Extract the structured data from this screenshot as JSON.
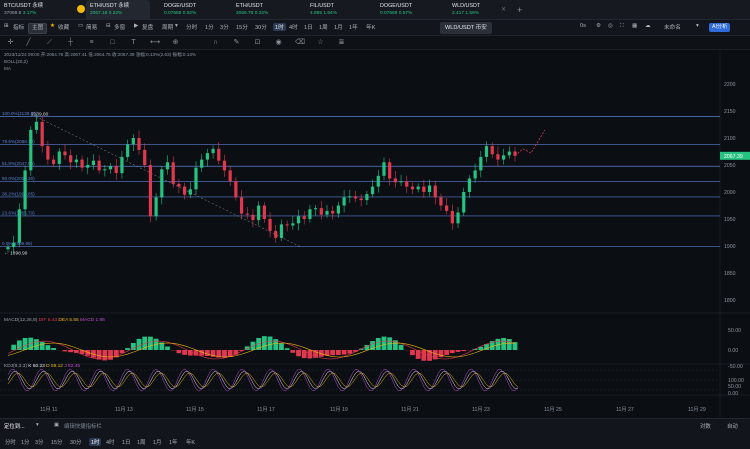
{
  "tabs": [
    {
      "name": "BTC/USDT 永续",
      "price": "37068.8",
      "change": "3.17%"
    },
    {
      "name": "ETH/USDT 永续",
      "price": "2067.18",
      "change": "0.22%"
    },
    {
      "name": "DOGE/USDT",
      "price": "0.07665",
      "change": "0.92%"
    },
    {
      "name": "ETH/USDT",
      "price": "2066.78",
      "change": "0.22%"
    },
    {
      "name": "FIL/USDT",
      "price": "4.895",
      "change": "1.64%"
    },
    {
      "name": "DOGE/USDT",
      "price": "0.07669",
      "change": "0.57%"
    },
    {
      "name": "WLD/USDT",
      "price": "2.417",
      "change": "1.59%"
    }
  ],
  "toolbar": {
    "indicator": "指标",
    "main_label": "主图",
    "favorite": "收藏",
    "simple": "简易",
    "multi": "多窗",
    "replay": "复盘",
    "cycle": "周期",
    "periods": [
      "分时",
      "1分",
      "3分",
      "15分",
      "30分",
      "1时",
      "4时",
      "1日",
      "1周",
      "1月",
      "1年",
      "年K"
    ],
    "selected_period": "1时",
    "pair_badge": "WLD/USDT 币安",
    "zero_s": "0s",
    "unnamed": "未命名",
    "ai": "AI分析"
  },
  "drawing_tools": [
    "cursor",
    "line",
    "ray",
    "cross",
    "fib",
    "shape",
    "text",
    "measure",
    "zoom",
    "magnet",
    "lock",
    "eye",
    "trash",
    "star",
    "layers"
  ],
  "legend": {
    "line1": "2023/11/24 09:00  开:2064.76  高:2067.41  低:2064.75  收:2067.39  涨幅:0.13%(2.63)  振幅:0.13%",
    "line2": "BOLL(20,2)",
    "line3": "MA"
  },
  "macd": {
    "label": "MACD(12,26,9)",
    "dif": "DIF 6.43",
    "dea": "DEA 5.55",
    "macd": "MACD 1.86"
  },
  "kdj": {
    "label": "KDJ(9,3,3)",
    "k": "K 60.23",
    "d": "D 59.12",
    "j": "J 62.45"
  },
  "chart_data": {
    "type": "candlestick",
    "price_axis": [
      2200,
      2150,
      2100,
      2050,
      2000,
      1950,
      1900,
      1850,
      1800
    ],
    "last_price": "2067.39",
    "high_label": "2139.60",
    "low_label": "1898.99",
    "fib_levels": [
      {
        "label": "100.0%(2139.60)",
        "value": 2139.6
      },
      {
        "label": "78.6%(2088.10)",
        "value": 2088.1
      },
      {
        "label": "61.8%(2047.66)",
        "value": 2047.66
      },
      {
        "label": "50.0%(2019.30)",
        "value": 2019.3
      },
      {
        "label": "38.2%(1990.85)",
        "value": 1990.85
      },
      {
        "label": "23.6%(1955.70)",
        "value": 1955.7
      },
      {
        "label": "0.0%(1898.99)",
        "value": 1898.99
      }
    ],
    "macd_axis": [
      "50.00",
      "0.00",
      "-50.00"
    ],
    "kdj_axis": [
      "100.00",
      "50.00",
      "0.00"
    ],
    "x_labels": [
      "11月 11",
      "11月 13",
      "11月 15",
      "11月 17",
      "11月 19",
      "11月 21",
      "11月 23",
      "11月 25",
      "11月 27",
      "11月 29"
    ],
    "closes": [
      1898,
      1906,
      1968,
      2040,
      2115,
      2130,
      2085,
      2060,
      2052,
      2075,
      2068,
      2055,
      2060,
      2045,
      2050,
      2058,
      2040,
      2042,
      2048,
      2035,
      2065,
      2088,
      2100,
      2078,
      2050,
      1955,
      1990,
      2042,
      2055,
      2015,
      2010,
      1995,
      2005,
      2045,
      2060,
      2072,
      2080,
      2058,
      2040,
      2020,
      1990,
      1960,
      1958,
      1948,
      1975,
      1950,
      1928,
      1915,
      1940,
      1938,
      1942,
      1955,
      1950,
      1968,
      1970,
      1958,
      1965,
      1960,
      1975,
      1990,
      1992,
      1988,
      1985,
      1996,
      2010,
      2030,
      2055,
      2025,
      2018,
      2020,
      2010,
      2005,
      2010,
      2000,
      2012,
      1990,
      1975,
      1965,
      1942,
      1962,
      2000,
      2025,
      2040,
      2065,
      2085,
      2070,
      2060,
      2068,
      2075,
      2067
    ]
  },
  "bottom": {
    "locate": "定位到...",
    "shortcut": "编辑快捷指标栏",
    "periods": [
      "分时",
      "1分",
      "3分",
      "15分",
      "30分",
      "1时",
      "4时",
      "1日",
      "1周",
      "1月",
      "1年",
      "年K"
    ],
    "selected_period": "1时",
    "right1": "对数",
    "right2": "自动"
  },
  "colors": {
    "up": "#26c281",
    "down": "#e0394f",
    "fib": "#5b7fd1",
    "accent": "#f0b90b",
    "bg": "#0b0e13"
  }
}
